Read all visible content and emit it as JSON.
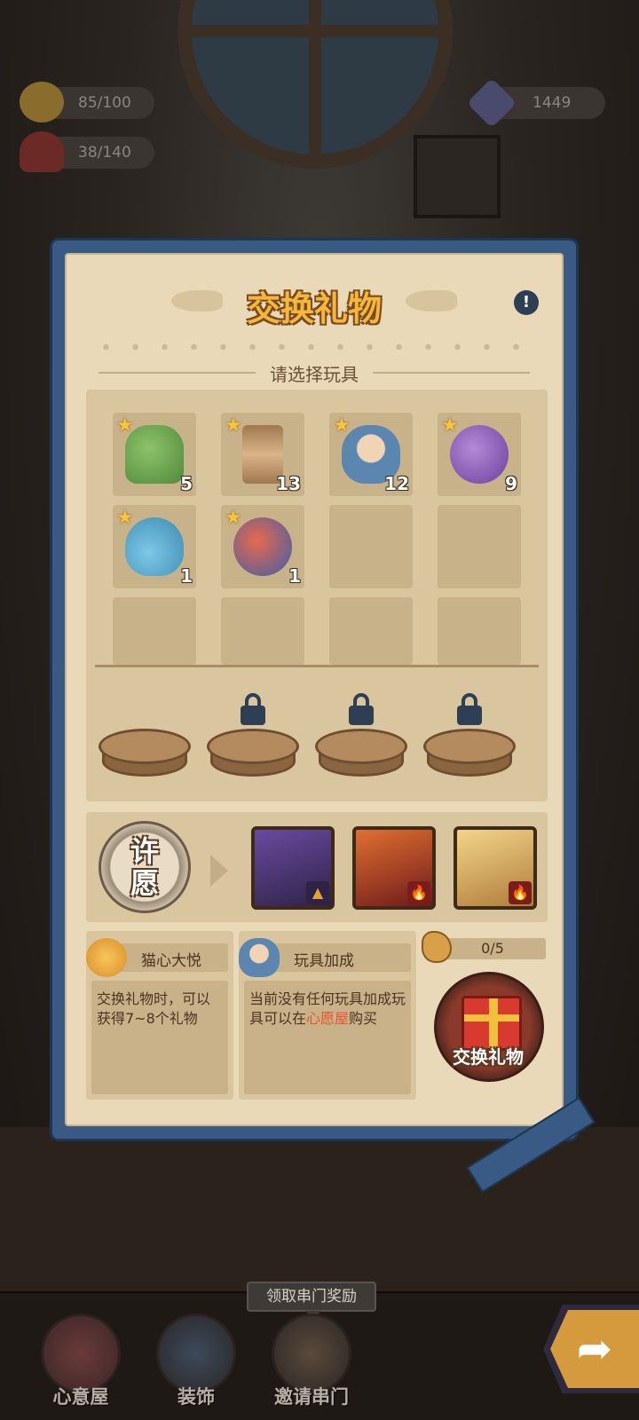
{
  "hud": {
    "mood": "85/100",
    "hearts": "38/140",
    "gems": "1449"
  },
  "panel": {
    "title": "交换礼物",
    "info_icon": "!",
    "subtitle": "请选择玩具"
  },
  "toys": [
    {
      "name": "plant",
      "count": "5",
      "star": "★"
    },
    {
      "name": "spool",
      "count": "13",
      "star": "★"
    },
    {
      "name": "doll",
      "count": "12",
      "star": "★"
    },
    {
      "name": "yarn",
      "count": "9",
      "star": "★"
    },
    {
      "name": "mouse",
      "count": "1",
      "star": "★"
    },
    {
      "name": "rattle",
      "count": "1",
      "star": "★"
    }
  ],
  "wish": {
    "badge_line1": "许",
    "badge_line2": "愿",
    "hero_elements": [
      "▲",
      "🔥",
      "🔥"
    ]
  },
  "bonus": {
    "cat": {
      "title": "猫心大悦",
      "text": "交换礼物时，可以获得7~8个礼物"
    },
    "toy": {
      "title": "玩具加成",
      "text_before": "当前没有任何玩具加成玩具可以在",
      "highlight": "心愿屋",
      "text_after": "购买"
    }
  },
  "exchange": {
    "progress": "0/5",
    "button_label": "交换礼物"
  },
  "tooltip": "领取串门奖励",
  "nav": {
    "wish_house": "心意屋",
    "decorate": "装饰",
    "invite": "邀请串门"
  },
  "colors": {
    "panel_frame": "#3a5a86",
    "panel_paper": "#e9d9b8",
    "title_gold": "#f4b73b",
    "highlight": "#e8532d"
  }
}
